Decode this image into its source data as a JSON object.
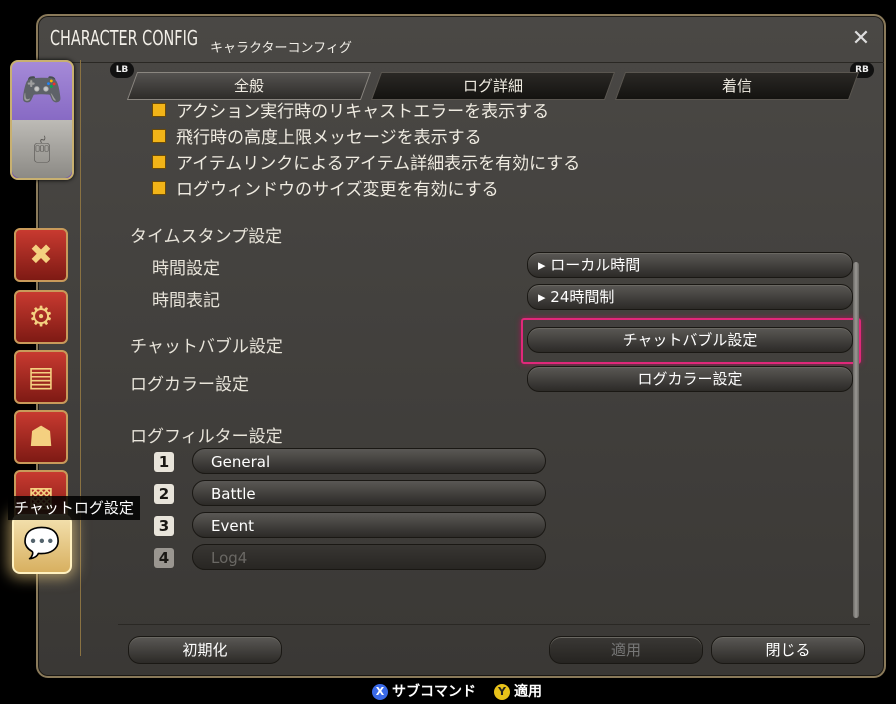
{
  "window": {
    "title": "CHARACTER CONFIG",
    "subtitle": "キャラクターコンフィグ",
    "close_glyph": "✕"
  },
  "sidebar": {
    "tooltip": "チャットログ設定",
    "pad_glyph": "🎮",
    "mouse_glyph": "🖱",
    "icons": [
      "✖",
      "⚙",
      "▤",
      "☗",
      "▩"
    ],
    "active_glyph": "💬"
  },
  "tabs": {
    "lb": "LB",
    "rb": "RB",
    "items": [
      {
        "label": "全般",
        "active": true
      },
      {
        "label": "ログ詳細",
        "active": false
      },
      {
        "label": "着信",
        "active": false
      }
    ]
  },
  "checkboxes": [
    "アクション実行時のリキャストエラーを表示する",
    "飛行時の高度上限メッセージを表示する",
    "アイテムリンクによるアイテム詳細表示を有効にする",
    "ログウィンドウのサイズ変更を有効にする"
  ],
  "timestamp": {
    "heading": "タイムスタンプ設定",
    "time_setting_label": "時間設定",
    "time_setting_value": "▸ ローカル時間",
    "time_format_label": "時間表記",
    "time_format_value": "▸ 24時間制"
  },
  "chat_bubble": {
    "label": "チャットバブル設定",
    "button": "チャットバブル設定"
  },
  "log_color": {
    "label": "ログカラー設定",
    "button": "ログカラー設定"
  },
  "log_filter": {
    "heading": "ログフィルター設定",
    "filters": [
      {
        "num": "1",
        "name": "General",
        "enabled": true
      },
      {
        "num": "2",
        "name": "Battle",
        "enabled": true
      },
      {
        "num": "3",
        "name": "Event",
        "enabled": true
      },
      {
        "num": "4",
        "name": "Log4",
        "enabled": false
      }
    ]
  },
  "footer": {
    "reset": "初期化",
    "apply": "適用",
    "close": "閉じる"
  },
  "hints": {
    "x_glyph": "X",
    "x_label": "サブコマンド",
    "y_glyph": "Y",
    "y_label": "適用"
  }
}
